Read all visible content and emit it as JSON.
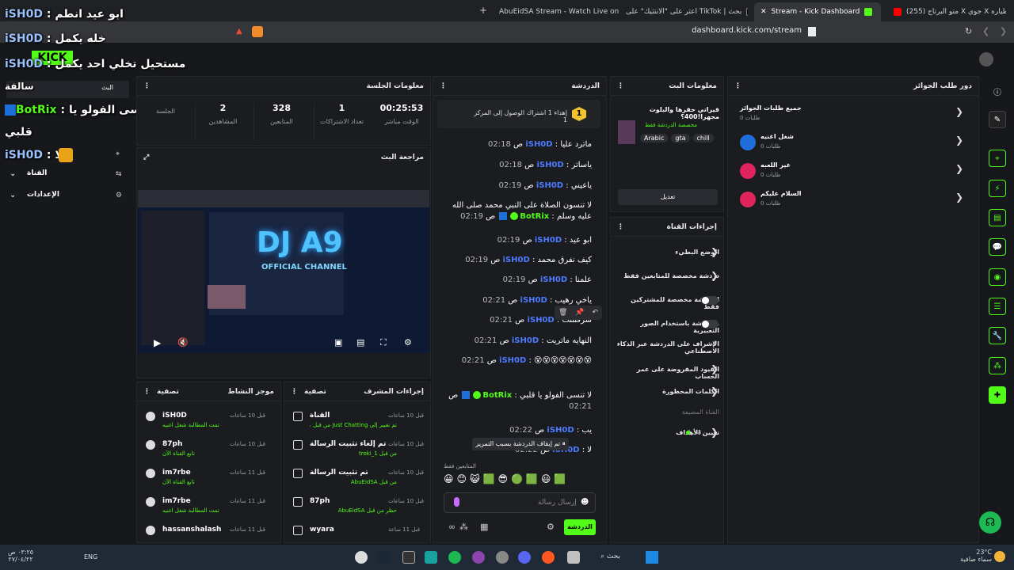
{
  "browser": {
    "tabs": [
      {
        "label": "(255) متو البرتاج X جوي X طياره"
      },
      {
        "label": "Stream - Kick Dashboard",
        "active": true
      },
      {
        "label": "اعثر على \"الانتثيك\" على TikTok | بحث"
      },
      {
        "label": "AbuEidSA Stream - Watch Live on Kick"
      }
    ],
    "url": "dashboard.kick.com/stream"
  },
  "overlay": {
    "lines": [
      {
        "user": "iSH0D",
        "sep": " : ",
        "text": "ابو عيد انطم"
      },
      {
        "user": "iSH0D",
        "sep": " : ",
        "text": "خله يكمل"
      },
      {
        "user": "iSH0D",
        "sep": " : ",
        "text": "مستحيل تخلي احد يكمل"
      },
      {
        "user": "BotRix",
        "sep": " : ",
        "text": "لا تنسى الفولو يا"
      },
      {
        "user": "",
        "sep": "",
        "text": "قلبي"
      },
      {
        "user": "iSH0D",
        "sep": " : ",
        "text": "لا"
      }
    ],
    "logo": "KICK"
  },
  "left_nav": {
    "sub": "سالفة",
    "items": [
      "البث",
      "الإنجازات",
      "القناة",
      "الإعدادات"
    ]
  },
  "session": {
    "title": "معلومات الجلسة",
    "stats": [
      {
        "value": "00:25:53",
        "label": "الوقت مباشر"
      },
      {
        "value": "1",
        "label": "تعداد الاشتراكات"
      },
      {
        "value": "328",
        "label": "المتابعين"
      },
      {
        "value": "2",
        "label": "المشاهدين"
      },
      {
        "value": "",
        "label": "الجلسة"
      }
    ],
    "live_badge": "البث"
  },
  "preview": {
    "title": "مراجعة البث",
    "stream_title": "DJ A9",
    "stream_sub": "OFFICIAL CHANNEL"
  },
  "activity": {
    "title": "موجز النشاط",
    "filter": "تصفية",
    "items": [
      {
        "user": "iSH0D",
        "desc": "تمت المطالبة شغل اغنيه",
        "time": "قبل 10 ساعات"
      },
      {
        "user": "87ph",
        "desc": "تابع القناة الآن",
        "time": "قبل 10 ساعات"
      },
      {
        "user": "im7rbe",
        "desc": "تابع القناة الآن",
        "time": "قبل 11 ساعات"
      },
      {
        "user": "im7rbe",
        "desc": "تمت المطالبة شغل اغنيه",
        "time": "قبل 11 ساعات"
      },
      {
        "user": "hassanshalash",
        "desc": "",
        "time": "قبل 11 ساعات"
      }
    ]
  },
  "mod": {
    "title": "إجراءات المشرف",
    "filter": "تصفية",
    "items": [
      {
        "title": "القناة",
        "desc": "تم تغيير إلى Just Chatting من قبل troki_1",
        "time": "قبل 10 ساعات"
      },
      {
        "title": "تم إلغاء تثبيت الرسالة",
        "desc": "من قبل troki_1",
        "time": "قبل 10 ساعات"
      },
      {
        "title": "تم تثبيت الرسالة",
        "desc": "من قبل AbuEidSA",
        "time": "قبل 10 ساعات"
      },
      {
        "title": "87ph",
        "desc": "حظر من قبل AbuEidSA",
        "time": "قبل 10 ساعات"
      },
      {
        "title": "wyara",
        "desc": "",
        "time": "قبل 11 ساعة"
      }
    ]
  },
  "chat": {
    "title": "الدردشة",
    "pinned": "إهداء 1 اشتراك الوصول إلى المركز 1",
    "pinned_num": "1",
    "messages": [
      {
        "time": "02:18",
        "user": "iSH0D",
        "text": "ماترد عليا"
      },
      {
        "time": "02:18",
        "user": "iSH0D",
        "text": "ياساتر"
      },
      {
        "time": "02:19",
        "user": "iSH0D",
        "text": "ياعيني"
      },
      {
        "time": "02:19",
        "user": "BotRix",
        "bot": true,
        "text": "لا تنسون الصلاة على النبي محمد صلى الله عليه وسلم"
      },
      {
        "time": "02:19",
        "user": "iSH0D",
        "text": "ابو عيد"
      },
      {
        "time": "02:19",
        "user": "iSH0D",
        "text": "كيف نفرق محمد"
      },
      {
        "time": "02:19",
        "user": "iSH0D",
        "text": "علمنا"
      },
      {
        "time": "02:21",
        "user": "iSH0D",
        "text": "ياخي رهيب"
      },
      {
        "time": "02:21",
        "user": "iSH0D",
        "text": "شرفتتتت"
      },
      {
        "time": "02:21",
        "user": "iSH0D",
        "text": "النهايه ماتريت"
      },
      {
        "time": "02:21",
        "user": "iSH0D",
        "text": "😵😵😵😵😵😵😵"
      },
      {
        "time": "02:21",
        "user": "BotRix",
        "bot": true,
        "text": "لا تنسى الفولو يا قلبي"
      },
      {
        "time": "02:22",
        "user": "iSH0D",
        "text": "يب"
      },
      {
        "time": "02:22",
        "user": "iSH0D",
        "text": "لا"
      }
    ],
    "paused": "تم إيقاف الدردشة بسبب التمرير",
    "followers_only": "المتابعين فقط",
    "placeholder": "إرسال رسالة",
    "send": "الدردشة"
  },
  "stream_info": {
    "title": "معلومات البث",
    "stream_title": "قيراتي حقرها والبلوت مجهزا!400؟",
    "category": "مخصصة الدردشة فقط",
    "tags": [
      "Arabic",
      "gta",
      "chill"
    ],
    "edit": "تعديل"
  },
  "channel_actions": {
    "title": "إجراءات القناة",
    "items": [
      {
        "label": "الوضع البطيء",
        "kind": "chevron"
      },
      {
        "label": "دردشة مخصصة للمتابعين فقط",
        "kind": "chevron"
      },
      {
        "label": "الدردشة مخصصة للمشتركين فقط",
        "kind": "toggle"
      },
      {
        "label": "...دردشة باستخدام الصور التعبيرية",
        "kind": "toggle"
      },
      {
        "label": "الإشراف على الدردشة عبر الذكاء الاصطناعي",
        "kind": "ext"
      },
      {
        "label": "القيود المفروضة على عمر الحساب",
        "kind": "chevron"
      },
      {
        "label": "الكلمات المحظورة",
        "kind": "chevron"
      },
      {
        "label": "القناة المضيفة",
        "kind": "none"
      },
      {
        "label": "تعيين الأهداف",
        "kind": "chevron",
        "extra": "قبل 1"
      }
    ]
  },
  "rewards": {
    "title": "دور طلب الجوائز",
    "items": [
      {
        "label": "جميع طلبات الجوائز",
        "sub": "طلبات 0"
      },
      {
        "label": "شغل اغنيه",
        "sub": "طلبات 0",
        "color": "#1e6fd9"
      },
      {
        "label": "غير اللعبه",
        "sub": "طلبات 0",
        "color": "#e0245e"
      },
      {
        "label": "السلام عليكم",
        "sub": "طلبات 0",
        "color": "#e0245e"
      }
    ]
  },
  "taskbar": {
    "weather_temp": "23°C",
    "weather_desc": "سماء صافية",
    "search": "بحث",
    "lang": "ENG",
    "time": "٠٣:٢٥ ص",
    "date": "٢٧/٠٤/٢٢"
  },
  "colors": {
    "accent": "#53fc18",
    "link": "#4c7bff"
  }
}
